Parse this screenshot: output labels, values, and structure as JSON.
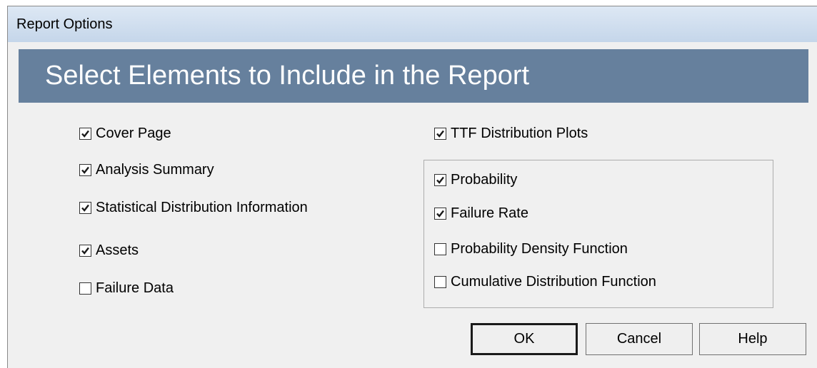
{
  "window": {
    "title": "Report Options"
  },
  "banner": {
    "heading": "Select Elements to Include in the Report",
    "color": "#66809d"
  },
  "left_options": [
    {
      "label": "Cover Page",
      "checked": true
    },
    {
      "label": "Analysis Summary",
      "checked": true
    },
    {
      "label": "Statistical Distribution Information",
      "checked": true
    },
    {
      "label": "Assets",
      "checked": true
    },
    {
      "label": "Failure Data",
      "checked": false
    }
  ],
  "ttf_distribution_plots": {
    "label": "TTF Distribution Plots",
    "checked": true
  },
  "plot_options": [
    {
      "label": "Probability",
      "checked": true
    },
    {
      "label": "Failure Rate",
      "checked": true
    },
    {
      "label": "Probability Density Function",
      "checked": false
    },
    {
      "label": "Cumulative Distribution Function",
      "checked": false
    }
  ],
  "buttons": {
    "ok": "OK",
    "cancel": "Cancel",
    "help": "Help"
  }
}
